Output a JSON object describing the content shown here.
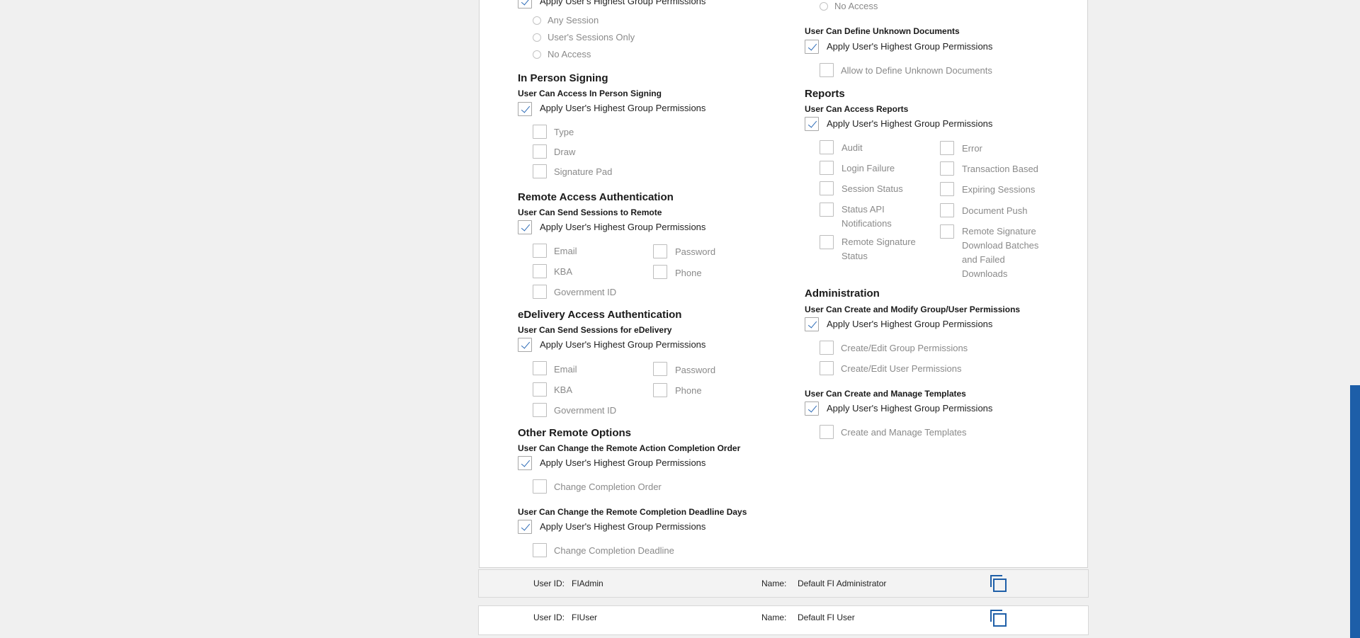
{
  "colors": {
    "accent": "#1f5fa8",
    "scrollbar": "#1d5ea8"
  },
  "icons": {
    "checkmark": "check-icon",
    "copy": "copy-icon"
  },
  "left": {
    "top_apply": "Apply User's Highest Group Permissions",
    "top_radios": [
      "Any Session",
      "User's Sessions Only",
      "No Access"
    ],
    "in_person": {
      "title": "In Person Signing",
      "sub": "User Can Access In Person Signing",
      "apply": "Apply User's Highest Group Permissions",
      "options": [
        "Type",
        "Draw",
        "Signature Pad"
      ]
    },
    "remote_auth": {
      "title": "Remote Access Authentication",
      "sub": "User Can Send Sessions to Remote",
      "apply": "Apply User's Highest Group Permissions",
      "col1": [
        "Email",
        "KBA",
        "Government ID"
      ],
      "col2": [
        "Password",
        "Phone"
      ]
    },
    "edelivery": {
      "title": "eDelivery Access Authentication",
      "sub": "User Can Send Sessions for eDelivery",
      "apply": "Apply User's Highest Group Permissions",
      "col1": [
        "Email",
        "KBA",
        "Government ID"
      ],
      "col2": [
        "Password",
        "Phone"
      ]
    },
    "other_remote": {
      "title": "Other Remote Options",
      "sub1": "User Can Change the Remote Action Completion Order",
      "apply1": "Apply User's Highest Group Permissions",
      "opt1": "Change Completion Order",
      "sub2": "User Can Change the Remote Completion Deadline Days",
      "apply2": "Apply User's Highest Group Permissions",
      "opt2": "Change Completion Deadline"
    }
  },
  "right": {
    "top_radio": "No Access",
    "unknown_docs": {
      "sub": "User Can Define Unknown Documents",
      "apply": "Apply User's Highest Group Permissions",
      "opt": "Allow to Define Unknown Documents"
    },
    "reports": {
      "title": "Reports",
      "sub": "User Can Access Reports",
      "apply": "Apply User's Highest Group Permissions",
      "col1": [
        "Audit",
        "Login Failure",
        "Session Status",
        "Status API Notifications",
        "Remote Signature Status"
      ],
      "col2": [
        "Error",
        "Transaction Based",
        "Expiring Sessions",
        "Document Push",
        "Remote Signature Download Batches and Failed Downloads"
      ]
    },
    "administration": {
      "title": "Administration",
      "sub": "User Can Create and Modify Group/User Permissions",
      "apply": "Apply User's Highest Group Permissions",
      "options": [
        "Create/Edit Group Permissions",
        "Create/Edit User Permissions"
      ]
    },
    "templates": {
      "sub": "User Can Create and Manage Templates",
      "apply": "Apply User's Highest Group Permissions",
      "opt": "Create and Manage Templates"
    }
  },
  "users": [
    {
      "id_label": "User ID:",
      "id": "FIAdmin",
      "name_label": "Name:",
      "name": "Default FI Administrator"
    },
    {
      "id_label": "User ID:",
      "id": "FIUser",
      "name_label": "Name:",
      "name": "Default FI User"
    }
  ]
}
